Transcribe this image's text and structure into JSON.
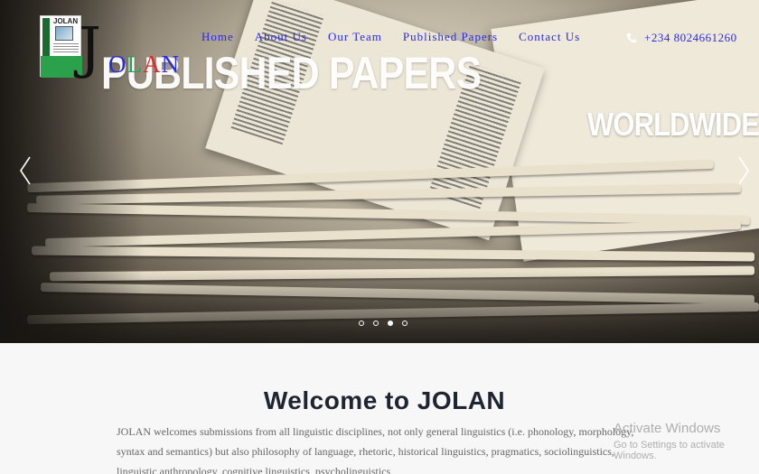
{
  "logo": {
    "word": "JOLAN",
    "big_letter": "J",
    "rest_letters": [
      "O",
      "L",
      "A",
      "N"
    ],
    "rest_colors": [
      "#2a2ae0",
      "#2aa14a",
      "#e02a2a",
      "#2a2ae0"
    ]
  },
  "nav": {
    "items": [
      "Home",
      "About Us",
      "Our Team",
      "Published Papers",
      "Contact Us"
    ],
    "phone": "+234 8024661260"
  },
  "hero": {
    "title": "PUBLISHED PAPERS",
    "subtitle": "WORLDWIDE",
    "slide_count": 4,
    "active_slide": 3
  },
  "welcome": {
    "heading": "Welcome to JOLAN",
    "text": "JOLAN welcomes submissions from all linguistic disciplines, not only general linguistics (i.e. phonology, morphology, syntax and semantics) but also philosophy of language, rhetoric, historical linguistics, pragmatics, sociolinguistics, linguistic anthropology, cognitive linguistics, psycholinguistics,"
  },
  "watermark": {
    "line1": "Activate Windows",
    "line2": "Go to Settings to activate Windows."
  },
  "colors": {
    "nav_link": "#2a2ae0",
    "heading": "#1f2530",
    "body_text": "#666666"
  },
  "icons": {
    "phone": "phone-icon",
    "prev": "chevron-left-icon",
    "next": "chevron-right-icon"
  }
}
